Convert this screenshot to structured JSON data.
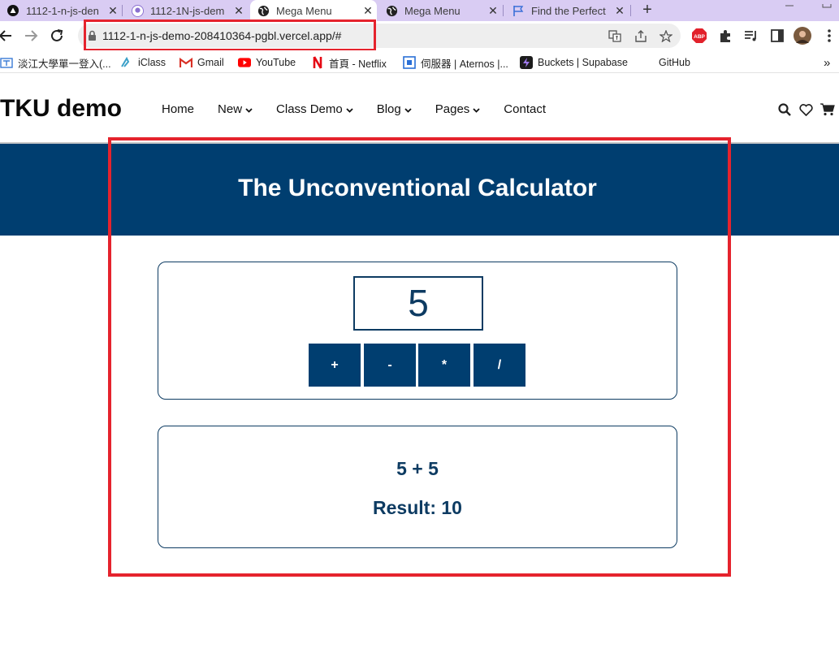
{
  "browser": {
    "tabs": [
      {
        "title": "1112-1-n-js-den",
        "icon": "vercel-triangle-icon",
        "active": false
      },
      {
        "title": "1112-1N-js-dem",
        "icon": "github-icon",
        "active": false
      },
      {
        "title": "Mega Menu",
        "icon": "globe-icon",
        "active": true
      },
      {
        "title": "Mega Menu",
        "icon": "globe-icon",
        "active": false
      },
      {
        "title": "Find the Perfect",
        "icon": "flag-icon",
        "active": false
      }
    ],
    "new_tab": "+",
    "close": "✕",
    "url": "1112-1-n-js-demo-208410364-pgbl.vercel.app/#",
    "bookmarks": [
      {
        "label": "淡江大學單一登入(...",
        "icon": "tku-icon"
      },
      {
        "label": "iClass",
        "icon": "iclass-icon"
      },
      {
        "label": "Gmail",
        "icon": "gmail-icon"
      },
      {
        "label": "YouTube",
        "icon": "youtube-icon"
      },
      {
        "label": "首頁 - Netflix",
        "icon": "netflix-icon"
      },
      {
        "label": "伺服器 | Aternos |...",
        "icon": "aternos-icon"
      },
      {
        "label": "Buckets | Supabase",
        "icon": "supabase-icon"
      },
      {
        "label": "GitHub",
        "icon": "github-icon"
      }
    ],
    "more": "»",
    "abp": "ABP"
  },
  "site": {
    "brand": "TKU demo",
    "nav": [
      {
        "label": "Home",
        "dropdown": false
      },
      {
        "label": "New",
        "dropdown": true
      },
      {
        "label": "Class Demo",
        "dropdown": true
      },
      {
        "label": "Blog",
        "dropdown": true
      },
      {
        "label": "Pages",
        "dropdown": true
      },
      {
        "label": "Contact",
        "dropdown": false
      }
    ]
  },
  "banner": {
    "title": "The Unconventional Calculator"
  },
  "calculator": {
    "input_value": "5",
    "operators": [
      "+",
      "-",
      "*",
      "/"
    ]
  },
  "output": {
    "expression": "5 + 5",
    "result": "Result: 10"
  },
  "colors": {
    "primary": "#003e70",
    "text": "#0d3b62",
    "annotation": "#e5232d",
    "tab_strip": "#d9ccf3"
  }
}
